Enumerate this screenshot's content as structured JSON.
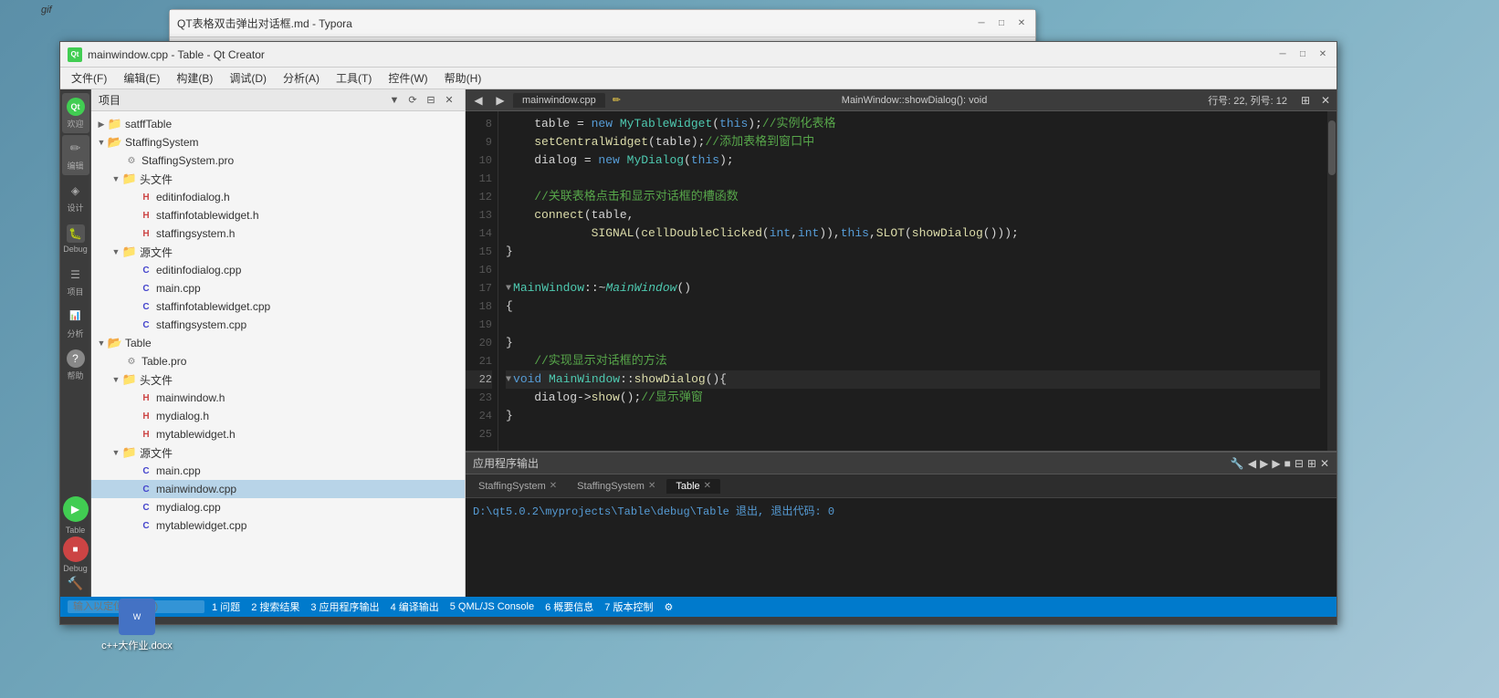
{
  "desktop": {
    "icons": [
      {
        "id": "gif-label",
        "label": "gif"
      },
      {
        "id": "cpp-homework",
        "label": "c++大作业.docx"
      }
    ]
  },
  "typora": {
    "title": "QT表格双击弹出对话框.md - Typora",
    "controls": {
      "minimize": "─",
      "maximize": "□",
      "close": "✕"
    }
  },
  "qtcreator": {
    "title": "mainwindow.cpp - Table - Qt Creator",
    "logo": "Qt",
    "menus": [
      "文件(F)",
      "编辑(E)",
      "构建(B)",
      "调试(D)",
      "分析(A)",
      "工具(T)",
      "控件(W)",
      "帮助(H)"
    ],
    "sidebar_icons": [
      {
        "id": "welcome",
        "label": "欢迎",
        "symbol": "Qt"
      },
      {
        "id": "edit",
        "label": "编辑",
        "symbol": "✏"
      },
      {
        "id": "design",
        "label": "设计",
        "symbol": "◈"
      },
      {
        "id": "debug",
        "label": "Debug",
        "symbol": "🐛"
      },
      {
        "id": "project",
        "label": "项目",
        "symbol": "☰"
      },
      {
        "id": "analyze",
        "label": "分析",
        "symbol": "📊"
      },
      {
        "id": "help",
        "label": "帮助",
        "symbol": "?"
      },
      {
        "id": "run-label",
        "label": "Table",
        "symbol": ""
      },
      {
        "id": "debug-label",
        "label": "Debug",
        "symbol": ""
      }
    ],
    "project_panel": {
      "header": "项目",
      "tree": [
        {
          "id": "satffTable",
          "label": "satffTable",
          "level": 0,
          "type": "folder",
          "expanded": false
        },
        {
          "id": "StaffingSystem",
          "label": "StaffingSystem",
          "level": 0,
          "type": "folder",
          "expanded": true
        },
        {
          "id": "StaffingSystem.pro",
          "label": "StaffingSystem.pro",
          "level": 1,
          "type": "pro"
        },
        {
          "id": "headers-1",
          "label": "头文件",
          "level": 1,
          "type": "folder",
          "expanded": true
        },
        {
          "id": "editinfodialog.h",
          "label": "editinfodialog.h",
          "level": 2,
          "type": "h"
        },
        {
          "id": "staffinfotablewidget.h",
          "label": "staffinfotablewidget.h",
          "level": 2,
          "type": "h"
        },
        {
          "id": "staffingsystem.h",
          "label": "staffingsystem.h",
          "level": 2,
          "type": "h"
        },
        {
          "id": "sources-1",
          "label": "源文件",
          "level": 1,
          "type": "folder",
          "expanded": true
        },
        {
          "id": "editinfodialog.cpp",
          "label": "editinfodialog.cpp",
          "level": 2,
          "type": "cpp"
        },
        {
          "id": "main.cpp-1",
          "label": "main.cpp",
          "level": 2,
          "type": "cpp"
        },
        {
          "id": "staffinfotablewidget.cpp",
          "label": "staffinfotablewidget.cpp",
          "level": 2,
          "type": "cpp"
        },
        {
          "id": "staffingsystem.cpp",
          "label": "staffingsystem.cpp",
          "level": 2,
          "type": "cpp"
        },
        {
          "id": "Table",
          "label": "Table",
          "level": 0,
          "type": "folder",
          "expanded": true
        },
        {
          "id": "Table.pro",
          "label": "Table.pro",
          "level": 1,
          "type": "pro"
        },
        {
          "id": "headers-2",
          "label": "头文件",
          "level": 1,
          "type": "folder",
          "expanded": true
        },
        {
          "id": "mainwindow.h",
          "label": "mainwindow.h",
          "level": 2,
          "type": "h"
        },
        {
          "id": "mydialog.h",
          "label": "mydialog.h",
          "level": 2,
          "type": "h"
        },
        {
          "id": "mytablewidget.h",
          "label": "mytablewidget.h",
          "level": 2,
          "type": "h"
        },
        {
          "id": "sources-2",
          "label": "源文件",
          "level": 1,
          "type": "folder",
          "expanded": true
        },
        {
          "id": "main.cpp-2",
          "label": "main.cpp",
          "level": 2,
          "type": "cpp"
        },
        {
          "id": "mainwindow.cpp",
          "label": "mainwindow.cpp",
          "level": 2,
          "type": "cpp",
          "selected": true
        },
        {
          "id": "mydialog.cpp",
          "label": "mydialog.cpp",
          "level": 2,
          "type": "cpp"
        },
        {
          "id": "mytablewidget.cpp",
          "label": "mytablewidget.cpp",
          "level": 2,
          "type": "cpp"
        }
      ]
    },
    "editor": {
      "file": "mainwindow.cpp",
      "function": "MainWindow::showDialog(): void",
      "line_info": "行号: 22, 列号: 12",
      "lines": [
        {
          "num": 8,
          "content": "    table = new MyTableWidget(this);//实例化表格",
          "active": false
        },
        {
          "num": 9,
          "content": "    setCentralWidget(table);//添加表格到窗口中",
          "active": false
        },
        {
          "num": 10,
          "content": "    dialog = new MyDialog(this);",
          "active": false
        },
        {
          "num": 11,
          "content": "",
          "active": false
        },
        {
          "num": 12,
          "content": "    //关联表格点击和显示对话框的槽函数",
          "active": false
        },
        {
          "num": 13,
          "content": "    connect(table,",
          "active": false
        },
        {
          "num": 14,
          "content": "            SIGNAL(cellDoubleClicked(int,int)),this,SLOT(showDialog()));",
          "active": false
        },
        {
          "num": 15,
          "content": "}",
          "active": false
        },
        {
          "num": 16,
          "content": "",
          "active": false
        },
        {
          "num": 17,
          "content": "MainWindow::~MainWindow()",
          "active": false,
          "collapsible": true
        },
        {
          "num": 18,
          "content": "{",
          "active": false
        },
        {
          "num": 19,
          "content": "",
          "active": false
        },
        {
          "num": 20,
          "content": "}",
          "active": false
        },
        {
          "num": 21,
          "content": "    //实现显示对话框的方法",
          "active": false
        },
        {
          "num": 22,
          "content": "void MainWindow::showDialog(){",
          "active": true,
          "collapsible": true
        },
        {
          "num": 23,
          "content": "    dialog->show();//显示弹窗",
          "active": false
        },
        {
          "num": 24,
          "content": "}",
          "active": false
        },
        {
          "num": 25,
          "content": "",
          "active": false
        }
      ]
    },
    "output": {
      "title": "应用程序输出",
      "tabs": [
        {
          "label": "StaffingSystem",
          "active": false,
          "closeable": true
        },
        {
          "label": "StaffingSystem",
          "active": false,
          "closeable": true
        },
        {
          "label": "Table",
          "active": true,
          "closeable": true
        }
      ],
      "content": "D:\\qt5.0.2\\myprojects\\Table\\debug\\Table 退出, 退出代码: 0"
    },
    "statusbar": {
      "search_placeholder": "输入以定位(Ctrl+K)",
      "items": [
        {
          "num": 1,
          "label": "问题"
        },
        {
          "num": 2,
          "label": "搜索结果"
        },
        {
          "num": 3,
          "label": "应用程序输出"
        },
        {
          "num": 4,
          "label": "编译输出"
        },
        {
          "num": 5,
          "label": "QML/JS Console"
        },
        {
          "num": 6,
          "label": "概要信息"
        },
        {
          "num": 7,
          "label": "版本控制"
        }
      ]
    }
  }
}
